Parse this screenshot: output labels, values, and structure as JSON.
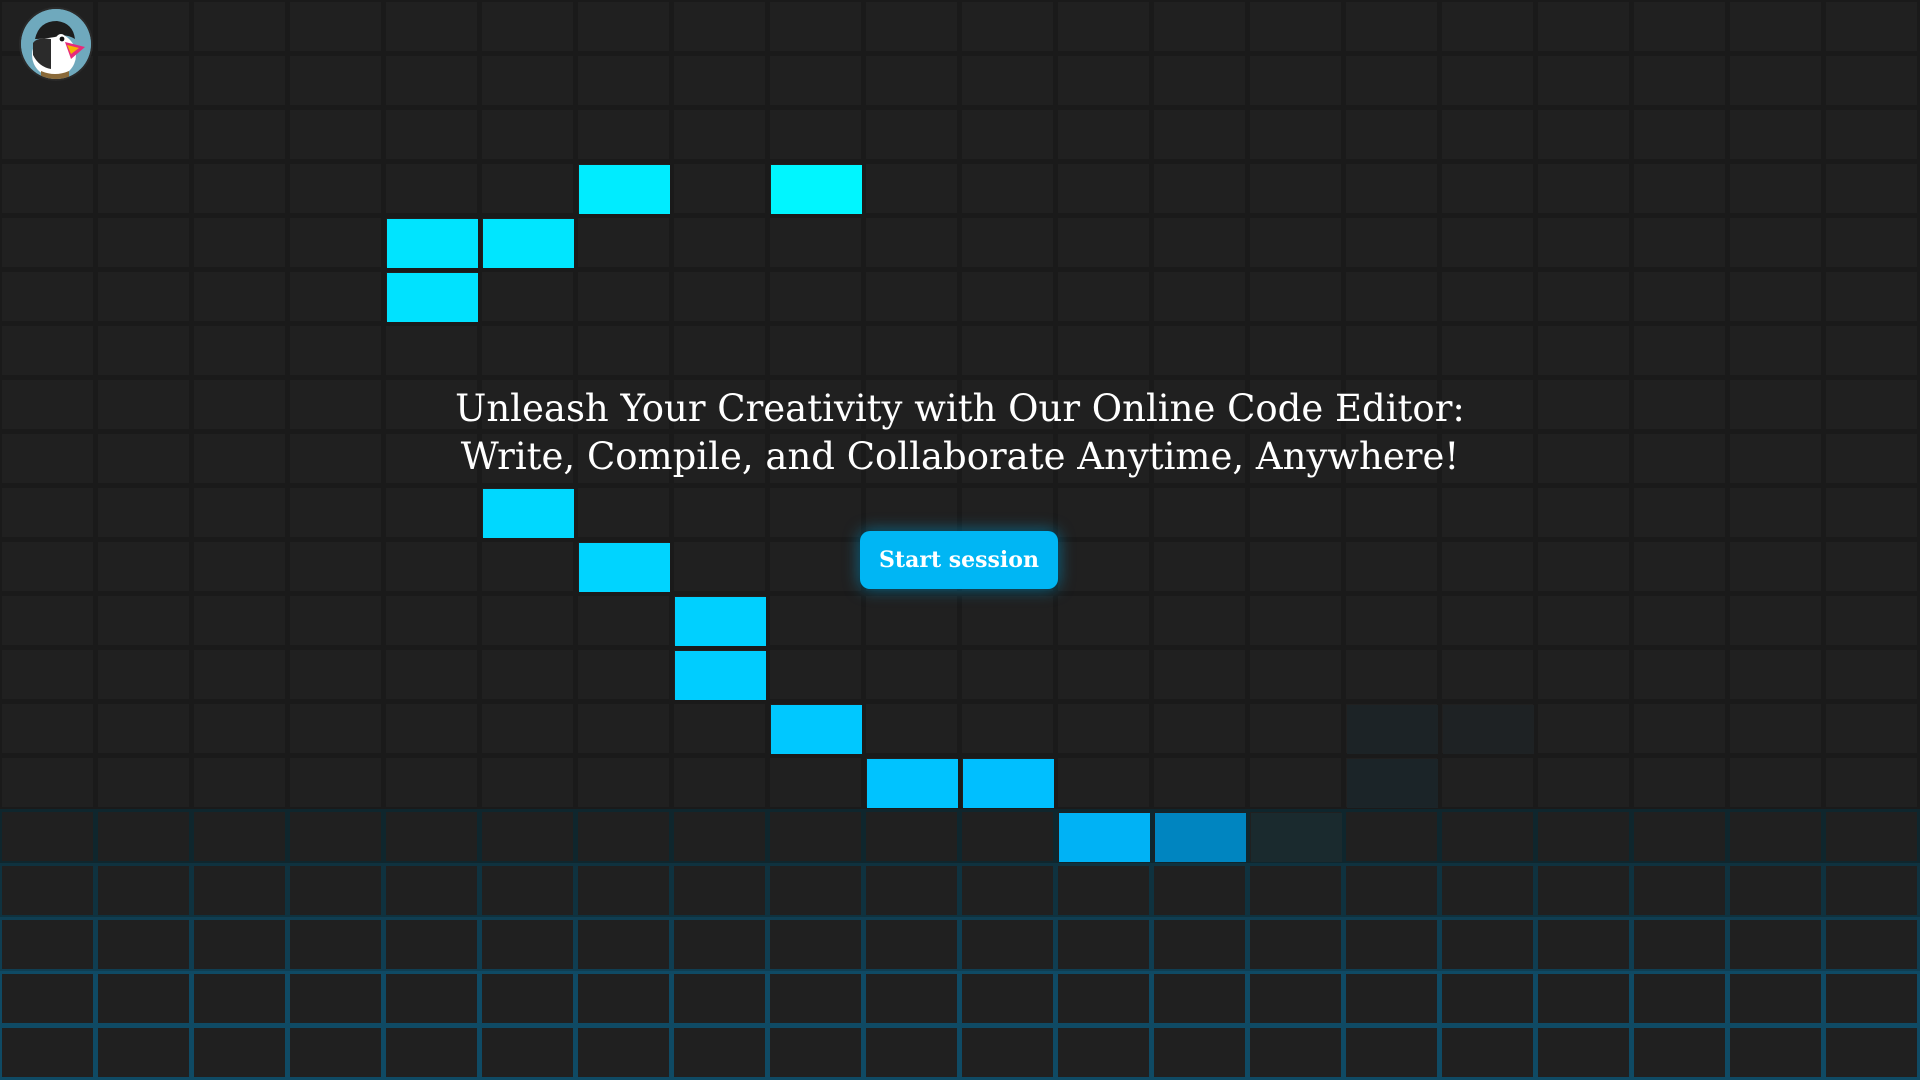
{
  "logo": {
    "icon": "puffin-logo-icon"
  },
  "hero": {
    "headline_line1": "Unleash Your Creativity with Our Online Code Editor:",
    "headline_line2": "Write, Compile, and Collaborate Anytime, Anywhere!"
  },
  "cta": {
    "start_label": "Start session"
  },
  "colors": {
    "background": "#202020",
    "grid_line": "#1a1a1a",
    "grid_glow": "#0f4a63",
    "tile_cyan": "#00f0ff",
    "tile_blue": "#00c8ff",
    "tile_deep": "#0085c0",
    "button": "#00b6f4"
  },
  "lit_tiles": [
    {
      "col": 6,
      "row": 3,
      "color": "#00ecff"
    },
    {
      "col": 8,
      "row": 3,
      "color": "#00f6ff"
    },
    {
      "col": 4,
      "row": 4,
      "color": "#00e4ff"
    },
    {
      "col": 5,
      "row": 4,
      "color": "#00e6ff"
    },
    {
      "col": 4,
      "row": 5,
      "color": "#00e2ff"
    },
    {
      "col": 5,
      "row": 9,
      "color": "#00d8ff"
    },
    {
      "col": 6,
      "row": 10,
      "color": "#00d4ff"
    },
    {
      "col": 7,
      "row": 11,
      "color": "#00d0ff"
    },
    {
      "col": 7,
      "row": 12,
      "color": "#00cdff"
    },
    {
      "col": 8,
      "row": 13,
      "color": "#00c8ff"
    },
    {
      "col": 9,
      "row": 14,
      "color": "#00c3ff"
    },
    {
      "col": 10,
      "row": 14,
      "color": "#00bfff"
    },
    {
      "col": 11,
      "row": 15,
      "color": "#00b2f5"
    },
    {
      "col": 12,
      "row": 15,
      "color": "#0085c0"
    },
    {
      "col": 13,
      "row": 15,
      "color": "#1a2a2e"
    },
    {
      "col": 14,
      "row": 13,
      "color": "#1c2326"
    },
    {
      "col": 15,
      "row": 13,
      "color": "#1e2224"
    },
    {
      "col": 14,
      "row": 14,
      "color": "#1b2428"
    }
  ]
}
